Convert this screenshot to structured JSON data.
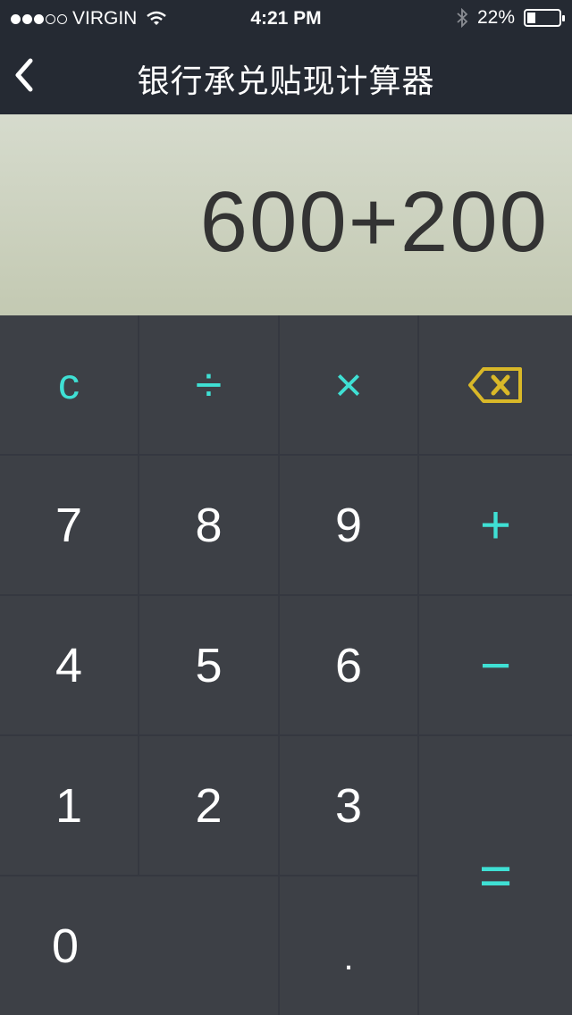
{
  "status_bar": {
    "carrier": "VIRGIN",
    "time": "4:21 PM",
    "battery": "22%",
    "signal_bars_filled": 3,
    "signal_bars_total": 5
  },
  "nav": {
    "title": "银行承兑贴现计算器",
    "back_icon": "chevron-left-icon"
  },
  "display": {
    "expression": "600+200"
  },
  "keys": {
    "clear": "c",
    "divide": "÷",
    "multiply": "×",
    "backspace_icon": "backspace-icon",
    "seven": "7",
    "eight": "8",
    "nine": "9",
    "plus": "+",
    "four": "4",
    "five": "5",
    "six": "6",
    "minus": "−",
    "one": "1",
    "two": "2",
    "three": "3",
    "equals": "=",
    "zero": "0",
    "decimal": "."
  },
  "colors": {
    "accent": "#3fe0d4",
    "backspace": "#d9b828",
    "keypad_bg": "#3d4046",
    "header_bg": "#252a33",
    "display_bg": "#cdd2be"
  }
}
